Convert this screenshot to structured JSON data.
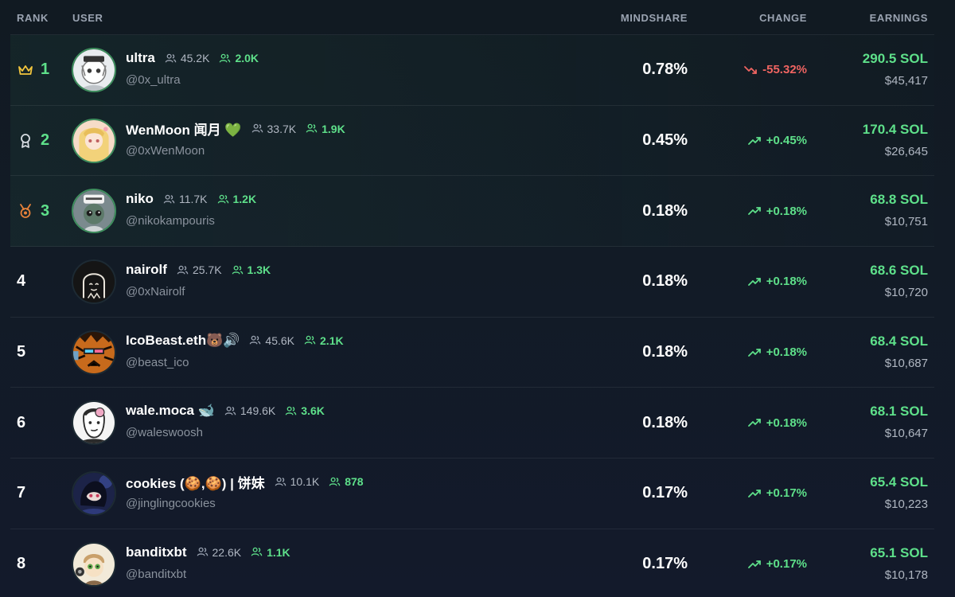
{
  "headers": {
    "rank": "RANK",
    "user": "USER",
    "mindshare": "MINDSHARE",
    "change": "CHANGE",
    "earnings": "EARNINGS"
  },
  "colors": {
    "accent_green": "#5ee08a",
    "negative_red": "#ef6461",
    "background": "#121b26"
  },
  "rows": [
    {
      "rank": "1",
      "rank_icon": "crown-icon",
      "name": "ultra",
      "followers": "45.2K",
      "smart_followers": "2.0K",
      "handle": "@0x_ultra",
      "mindshare": "0.78%",
      "change": "-55.32%",
      "change_dir": "down",
      "sol": "290.5 SOL",
      "usd": "$45,417"
    },
    {
      "rank": "2",
      "rank_icon": "award-ribbon-icon",
      "name": "WenMoon 闻月 💚",
      "followers": "33.7K",
      "smart_followers": "1.9K",
      "handle": "@0xWenMoon",
      "mindshare": "0.45%",
      "change": "+0.45%",
      "change_dir": "up",
      "sol": "170.4 SOL",
      "usd": "$26,645"
    },
    {
      "rank": "3",
      "rank_icon": "medal-icon",
      "name": "niko",
      "followers": "11.7K",
      "smart_followers": "1.2K",
      "handle": "@nikokampouris",
      "mindshare": "0.18%",
      "change": "+0.18%",
      "change_dir": "up",
      "sol": "68.8 SOL",
      "usd": "$10,751"
    },
    {
      "rank": "4",
      "name": "nairolf",
      "followers": "25.7K",
      "smart_followers": "1.3K",
      "handle": "@0xNairolf",
      "mindshare": "0.18%",
      "change": "+0.18%",
      "change_dir": "up",
      "sol": "68.6 SOL",
      "usd": "$10,720"
    },
    {
      "rank": "5",
      "name": "IcoBeast.eth🐻🔊",
      "followers": "45.6K",
      "smart_followers": "2.1K",
      "handle": "@beast_ico",
      "mindshare": "0.18%",
      "change": "+0.18%",
      "change_dir": "up",
      "sol": "68.4 SOL",
      "usd": "$10,687"
    },
    {
      "rank": "6",
      "name": "wale.moca 🐋",
      "followers": "149.6K",
      "smart_followers": "3.6K",
      "handle": "@waleswoosh",
      "mindshare": "0.18%",
      "change": "+0.18%",
      "change_dir": "up",
      "sol": "68.1 SOL",
      "usd": "$10,647"
    },
    {
      "rank": "7",
      "name": "cookies (🍪,🍪) | 饼妹",
      "followers": "10.1K",
      "smart_followers": "878",
      "handle": "@jinglingcookies",
      "mindshare": "0.17%",
      "change": "+0.17%",
      "change_dir": "up",
      "sol": "65.4 SOL",
      "usd": "$10,223"
    },
    {
      "rank": "8",
      "name": "banditxbt",
      "followers": "22.6K",
      "smart_followers": "1.1K",
      "handle": "@banditxbt",
      "mindshare": "0.17%",
      "change": "+0.17%",
      "change_dir": "up",
      "sol": "65.1 SOL",
      "usd": "$10,178"
    }
  ]
}
